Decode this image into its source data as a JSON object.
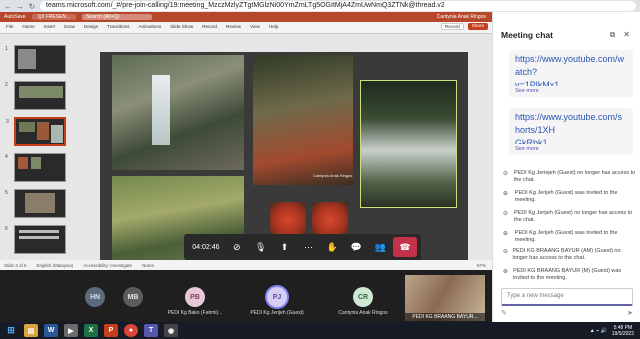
{
  "browser": {
    "back": "←",
    "forward": "→",
    "reload": "↻",
    "url": "teams.microsoft.com/_#/pre-join-calling/19:meeting_MzczMzlyZTgtMGlzNi00YmZmLTg5OGItMjA4ZmUwNmQ3ZTNk@thread.v2"
  },
  "powerpoint": {
    "title_left": "AutoSave",
    "file_name": "Q3 FRESEN...",
    "search_placeholder": "Search (Alt+Q)",
    "user": "Cantynia Anak Ringos",
    "menu": [
      "File",
      "Home",
      "Insert",
      "Draw",
      "Design",
      "Transitions",
      "Animations",
      "Slide Show",
      "Record",
      "Review",
      "View",
      "Help"
    ],
    "record_label": "Record",
    "share_label": "Share",
    "status_slide": "Slide 3 of 6",
    "status_lang": "English (Malaysia)",
    "status_access": "Accessibility: Investigate",
    "notes_label": "Notes",
    "zoom": "57%",
    "slide_caption": "Cantynia Anak Ringos",
    "thumb_numbers": [
      "1",
      "2",
      "3",
      "4",
      "5",
      "6"
    ]
  },
  "call": {
    "timer": "04:02:46"
  },
  "chat": {
    "title": "Meeting chat",
    "links": [
      {
        "text": "https://www.youtube.com/watch?",
        "tail": "v=1PlkMx1...",
        "more": "See more"
      },
      {
        "text": "https://www.youtube.com/shorts/1XH",
        "tail": "GkRbk1...",
        "more": "See more"
      }
    ],
    "messages": [
      "PEDI Kg Jeriejeh (Guest) no longer has access to the chat.",
      "PEDI Kg Jerijeh (Guest) was invited to the meeting.",
      "PEDI Kg Jerijeh (Guest) no longer has access to the chat.",
      "PEDI Kg Jerijeh (Guest) was invited to the meeting.",
      "PEDI KG BRAANG BAYUR (AM) (Guest) no longer has access to the chat.",
      "PEDI KG BRAANG BAYUR (M) (Guest) was invited to the meeting."
    ],
    "compose_placeholder": "Type a new message"
  },
  "gallery": [
    {
      "initials": "HN",
      "name": "",
      "bg": "#5b6b7b",
      "fg": "#cfe0f0"
    },
    {
      "initials": "MB",
      "name": "",
      "bg": "#5c5c5c",
      "fg": "#e6e6e6"
    },
    {
      "initials": "PB",
      "name": "PEDI Kg Bako (Fahmi)...",
      "bg": "#e8c7d6",
      "fg": "#8a3f60"
    },
    {
      "initials": "PJ",
      "name": "PEDI Kg Jerijeh (Guest)",
      "bg": "#d8cdf3",
      "fg": "#5b4ca6"
    },
    {
      "initials": "CR",
      "name": "Cantynia Anak Ringos",
      "bg": "#cfe8d6",
      "fg": "#2f6b43"
    }
  ],
  "video_tile_name": "PEDI KG BRAANG BAYUR...",
  "taskbar": {
    "time": "5:48 PM",
    "date": "19/5/2022",
    "start": "⊞",
    "tray_icons": "▲ ⌁ 🔊"
  }
}
